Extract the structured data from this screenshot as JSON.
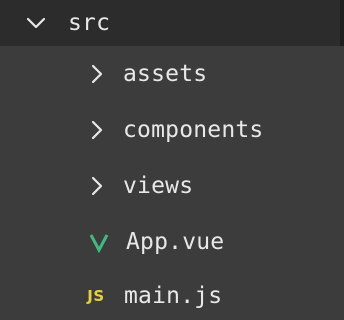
{
  "explorer": {
    "root": {
      "label": "src",
      "icon": "chevron-down-icon",
      "expanded": true
    },
    "items": [
      {
        "label": "assets",
        "type": "folder",
        "icon": "chevron-right-icon",
        "expanded": false
      },
      {
        "label": "components",
        "type": "folder",
        "icon": "chevron-right-icon",
        "expanded": false
      },
      {
        "label": "views",
        "type": "folder",
        "icon": "chevron-right-icon",
        "expanded": false
      },
      {
        "label": "App.vue",
        "type": "file",
        "icon": "vue-file-icon",
        "icon_glyph": "V",
        "icon_color": "#42b883"
      },
      {
        "label": "main.js",
        "type": "file",
        "icon": "js-file-icon",
        "icon_glyph": "JS",
        "icon_color": "#e5d03d"
      }
    ]
  },
  "colors": {
    "background": "#3c3c3c",
    "root_row_background": "#2c2c2c",
    "text": "#e8e8e8"
  }
}
